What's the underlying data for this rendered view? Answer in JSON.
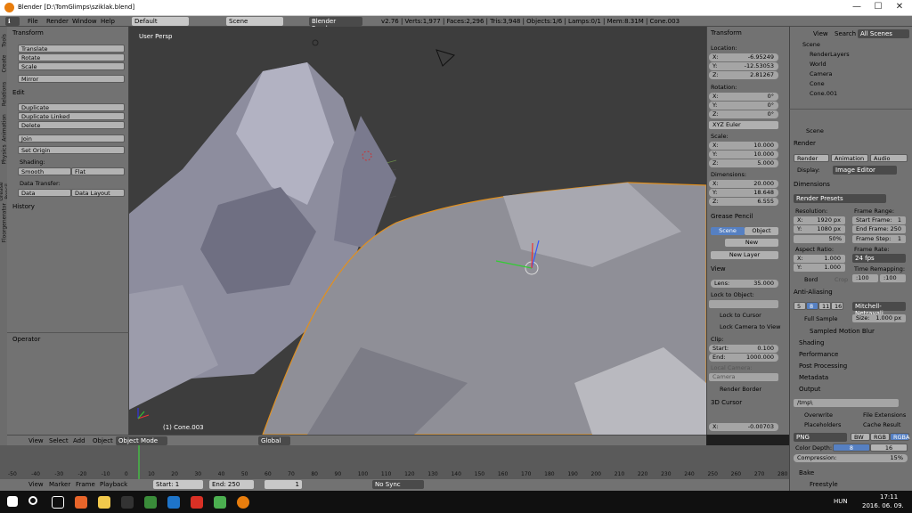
{
  "window": {
    "title": "Blender [D:\\TomGlimps\\sziklak.blend]",
    "min": "—",
    "max": "☐",
    "close": "✕"
  },
  "infobar": {
    "menus": [
      "File",
      "Render",
      "Window",
      "Help"
    ],
    "layout": "Default",
    "scene": "Scene",
    "engine": "Blender Render",
    "stats": "v2.76 | Verts:1,977 | Faces:2,296 | Tris:3,948 | Objects:1/6 | Lamps:0/1 | Mem:8.31M | Cone.003"
  },
  "lefttabs": [
    "Tools",
    "Create",
    "Relations",
    "Animation",
    "Physics",
    "Grease Pencil",
    "Floorgenerator"
  ],
  "tools": {
    "transform_header": "Transform",
    "translate": "Translate",
    "rotate": "Rotate",
    "scale": "Scale",
    "mirror": "Mirror",
    "edit_header": "Edit",
    "duplicate": "Duplicate",
    "duplicate_linked": "Duplicate Linked",
    "delete": "Delete",
    "join": "Join",
    "set_origin": "Set Origin",
    "shading_label": "Shading:",
    "smooth": "Smooth",
    "flat": "Flat",
    "data_transfer_label": "Data Transfer:",
    "data": "Data",
    "data_layout": "Data Layout",
    "history_header": "History",
    "operator_header": "Operator"
  },
  "viewport": {
    "view_name": "User Persp",
    "object_label": "(1) Cone.003"
  },
  "vheader": {
    "view": "View",
    "select": "Select",
    "add": "Add",
    "object": "Object",
    "mode": "Object Mode",
    "orientation": "Global"
  },
  "timeline": {
    "ticks": [
      "-50",
      "-40",
      "-30",
      "-20",
      "-10",
      "0",
      "10",
      "20",
      "30",
      "40",
      "50",
      "60",
      "70",
      "80",
      "90",
      "100",
      "110",
      "120",
      "130",
      "140",
      "150",
      "160",
      "170",
      "180",
      "190",
      "200",
      "210",
      "220",
      "230",
      "240",
      "250",
      "260",
      "270",
      "280"
    ],
    "view": "View",
    "marker": "Marker",
    "frame": "Frame",
    "playback": "Playback",
    "start_label": "Start:",
    "start": "1",
    "end_label": "End:",
    "end": "250",
    "current": "1",
    "sync": "No Sync"
  },
  "props": {
    "transform_header": "Transform",
    "location_label": "Location:",
    "loc_x": "-6.95249",
    "loc_y": "-12.53053",
    "loc_z": "2.81267",
    "rotation_label": "Rotation:",
    "rot_x": "0°",
    "rot_y": "0°",
    "rot_z": "0°",
    "rot_mode": "XYZ Euler",
    "scale_label": "Scale:",
    "sc_x": "10.000",
    "sc_y": "10.000",
    "sc_z": "5.000",
    "dimensions_label": "Dimensions:",
    "dim_x": "20.000",
    "dim_y": "18.648",
    "dim_z": "6.555",
    "gp_header": "Grease Pencil",
    "gp_scene": "Scene",
    "gp_object": "Object",
    "gp_new": "New",
    "gp_new_layer": "New Layer",
    "view_header": "View",
    "lens_label": "Lens:",
    "lens": "35.000",
    "lock_label": "Lock to Object:",
    "lock_cursor": "Lock to Cursor",
    "lock_camera": "Lock Camera to View",
    "clip_label": "Clip:",
    "clip_start_label": "Start:",
    "clip_start": "0.100",
    "clip_end_label": "End:",
    "clip_end": "1000.000",
    "local_camera_label": "Local Camera:",
    "local_camera": "Camera",
    "render_border": "Render Border",
    "cursor_header": "3D Cursor",
    "cursor_x": "-0.00703",
    "axis_x": "X:",
    "axis_y": "Y:",
    "axis_z": "Z:"
  },
  "outliner": {
    "view": "View",
    "search": "Search",
    "filter": "All Scenes",
    "items": [
      "Scene",
      "RenderLayers",
      "World",
      "Camera",
      "Cone",
      "Cone.001"
    ]
  },
  "render": {
    "scene": "Scene",
    "render_header": "Render",
    "render_btn": "Render",
    "animation_btn": "Animation",
    "audio_btn": "Audio",
    "display_label": "Display:",
    "display": "Image Editor",
    "dimensions_header": "Dimensions",
    "presets": "Render Presets",
    "resolution_label": "Resolution:",
    "res_x": "1920 px",
    "res_y": "1080 px",
    "res_pct": "50%",
    "frame_range_label": "Frame Range:",
    "start_frame": "Start Frame:",
    "start_frame_v": "1",
    "end_frame": "End Frame:",
    "end_frame_v": "250",
    "frame_step": "Frame Step:",
    "frame_step_v": "1",
    "aspect_label": "Aspect Ratio:",
    "asp_x": "1.000",
    "asp_y": "1.000",
    "frame_rate_label": "Frame Rate:",
    "frame_rate": "24 fps",
    "time_remap": "Time Remapping:",
    "remap_old": ":100",
    "remap_new": ":100",
    "bord": "Bord",
    "crop": "Crop",
    "aa_header": "Anti-Aliasing",
    "aa_samples": [
      "5",
      "8",
      "11",
      "16"
    ],
    "aa_filter": "Mitchell-Netravali",
    "full_sample": "Full Sample",
    "size_label": "Size:",
    "size": "1.000 px",
    "motion_blur": "Sampled Motion Blur",
    "shading": "Shading",
    "performance": "Performance",
    "post_processing": "Post Processing",
    "metadata": "Metadata",
    "output_header": "Output",
    "output_path": "/tmp\\",
    "overwrite": "Overwrite",
    "file_ext": "File Extensions",
    "placeholders": "Placeholders",
    "cache_result": "Cache Result",
    "format": "PNG",
    "bw": "BW",
    "rgb": "RGB",
    "rgba": "RGBA",
    "color_depth_label": "Color Depth:",
    "depth8": "8",
    "depth16": "16",
    "compression_label": "Compression:",
    "compression": "15%",
    "bake": "Bake",
    "freestyle": "Freestyle"
  },
  "taskbar": {
    "lang": "HUN",
    "time": "17:11",
    "date": "2016. 06. 09."
  },
  "colors": {
    "accent": "#e87d0d",
    "panel": "#727272",
    "viewport": "#3d3d3d"
  }
}
